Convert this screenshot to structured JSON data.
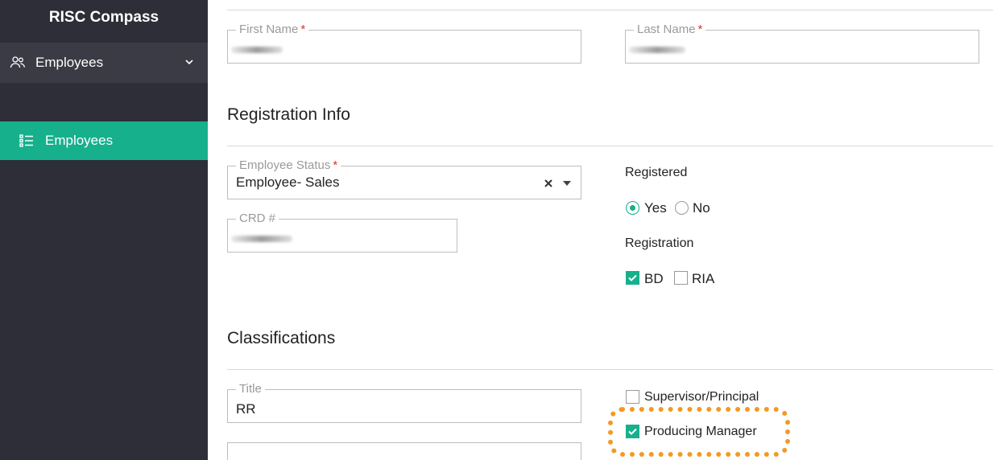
{
  "sidebar": {
    "brand": "RISC Compass",
    "group_label": "Employees",
    "active_item_label": "Employees"
  },
  "personal": {
    "first_name_label": "First Name",
    "last_name_label": "Last Name",
    "required_mark": "*"
  },
  "registration": {
    "section_title": "Registration Info",
    "employee_status_label": "Employee Status",
    "employee_status_value": "Employee- Sales",
    "crd_label": "CRD #",
    "registered_label": "Registered",
    "registered_options": [
      "Yes",
      "No"
    ],
    "registered_selected": "Yes",
    "registration_label": "Registration",
    "registration_options": [
      {
        "label": "BD",
        "checked": true
      },
      {
        "label": "RIA",
        "checked": false
      }
    ]
  },
  "classifications": {
    "section_title": "Classifications",
    "title_label": "Title",
    "title_value": "RR",
    "checkboxes": [
      {
        "label": "Supervisor/Principal",
        "checked": false
      },
      {
        "label": "Producing Manager",
        "checked": true
      }
    ]
  },
  "colors": {
    "accent": "#16b08c",
    "sidebar_bg": "#2e2e38",
    "highlight": "#f29a21",
    "required": "#e03030"
  }
}
